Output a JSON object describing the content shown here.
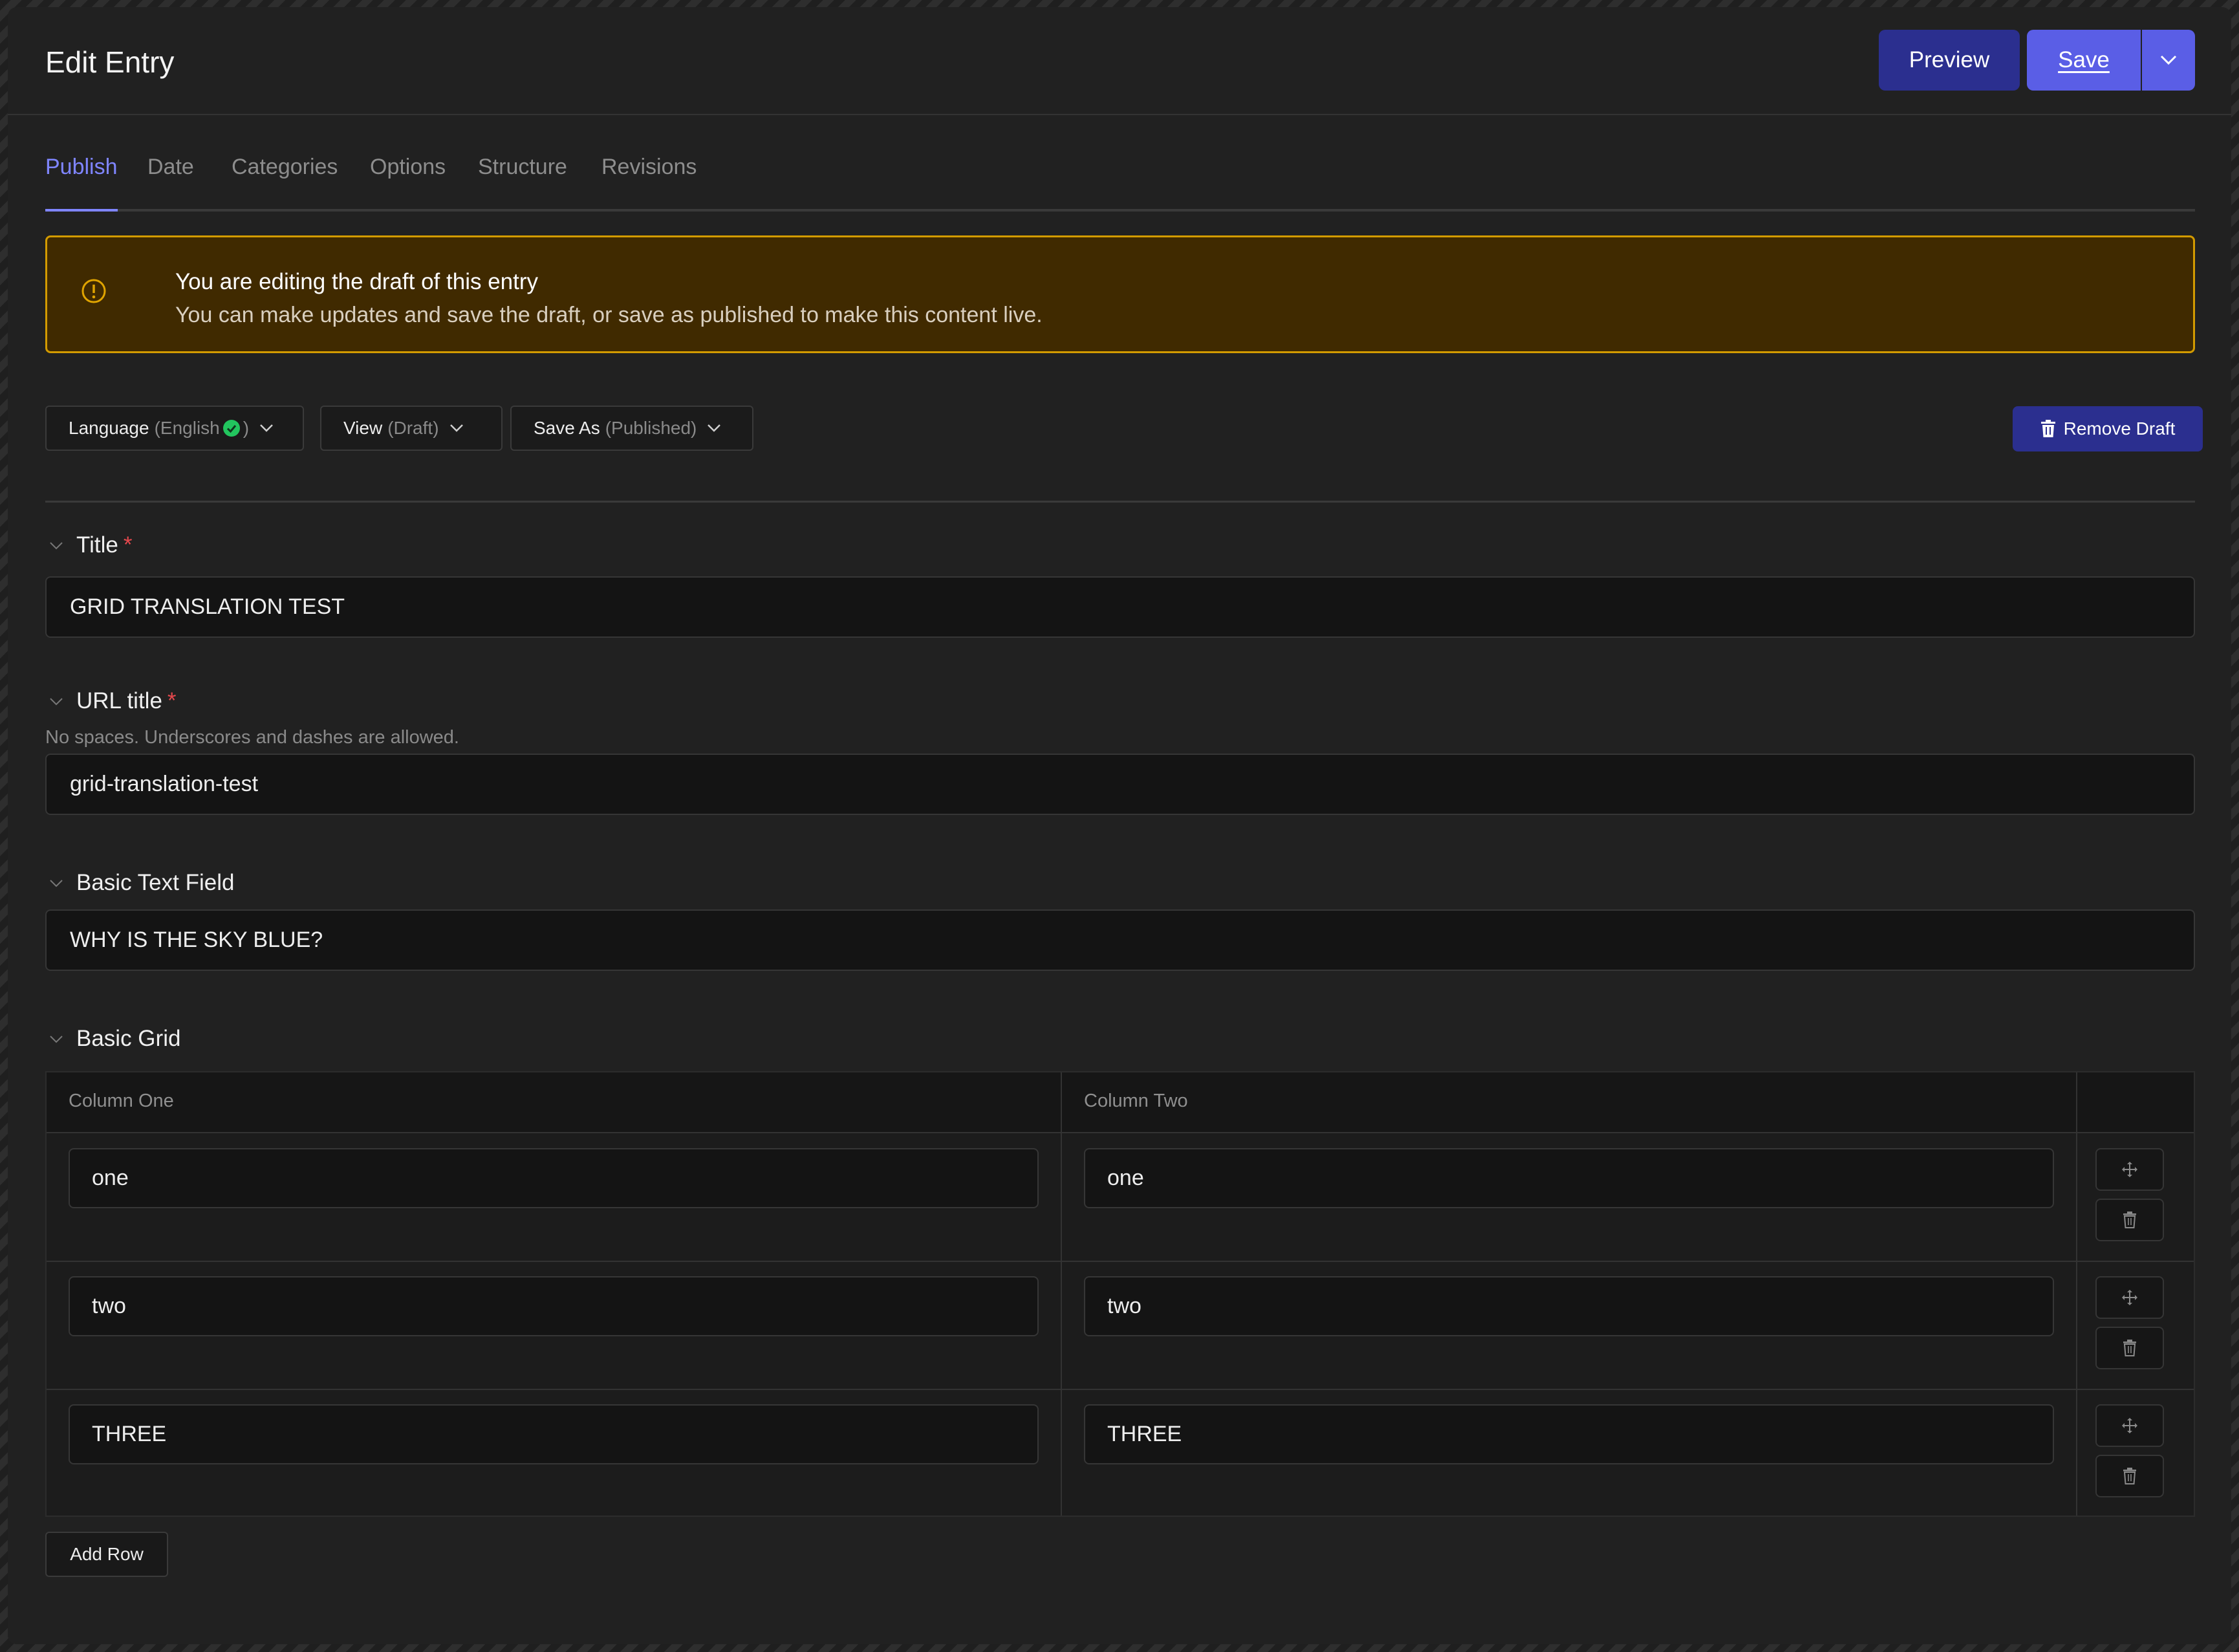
{
  "header": {
    "title": "Edit Entry",
    "preview_label": "Preview",
    "save_label": "Save"
  },
  "tabs": [
    {
      "label": "Publish",
      "active": true
    },
    {
      "label": "Date"
    },
    {
      "label": "Categories"
    },
    {
      "label": "Options"
    },
    {
      "label": "Structure"
    },
    {
      "label": "Revisions"
    }
  ],
  "alert": {
    "icon": "alert-circle-icon",
    "title": "You are editing the draft of this entry",
    "text": "You can make updates and save the draft, or save as published to make this content live."
  },
  "toolbar": {
    "language": {
      "label": "Language",
      "open": "(English",
      "close": ")"
    },
    "view": {
      "label": "View",
      "value": "(Draft)"
    },
    "save_as": {
      "label": "Save As",
      "value": "(Published)"
    },
    "remove_draft_label": "Remove Draft"
  },
  "fields": {
    "title": {
      "label": "Title",
      "required_mark": "*",
      "value": "GRID TRANSLATION TEST"
    },
    "url_title": {
      "label": "URL title",
      "required_mark": "*",
      "hint": "No spaces. Underscores and dashes are allowed.",
      "value": "grid-translation-test"
    },
    "basic_text": {
      "label": "Basic Text Field",
      "value": "WHY IS THE SKY BLUE?"
    },
    "basic_grid": {
      "label": "Basic Grid",
      "columns": [
        "Column One",
        "Column Two"
      ],
      "rows": [
        [
          "one",
          "one"
        ],
        [
          "two",
          "two"
        ],
        [
          "THREE",
          "THREE"
        ]
      ],
      "add_row_label": "Add Row"
    }
  },
  "colors": {
    "accent": "#5a5ee6",
    "accent_dark": "#2b2f8f",
    "warning_border": "#d39b00",
    "warning_bg": "#402a00",
    "required": "#e5484d",
    "success": "#22c55e"
  }
}
